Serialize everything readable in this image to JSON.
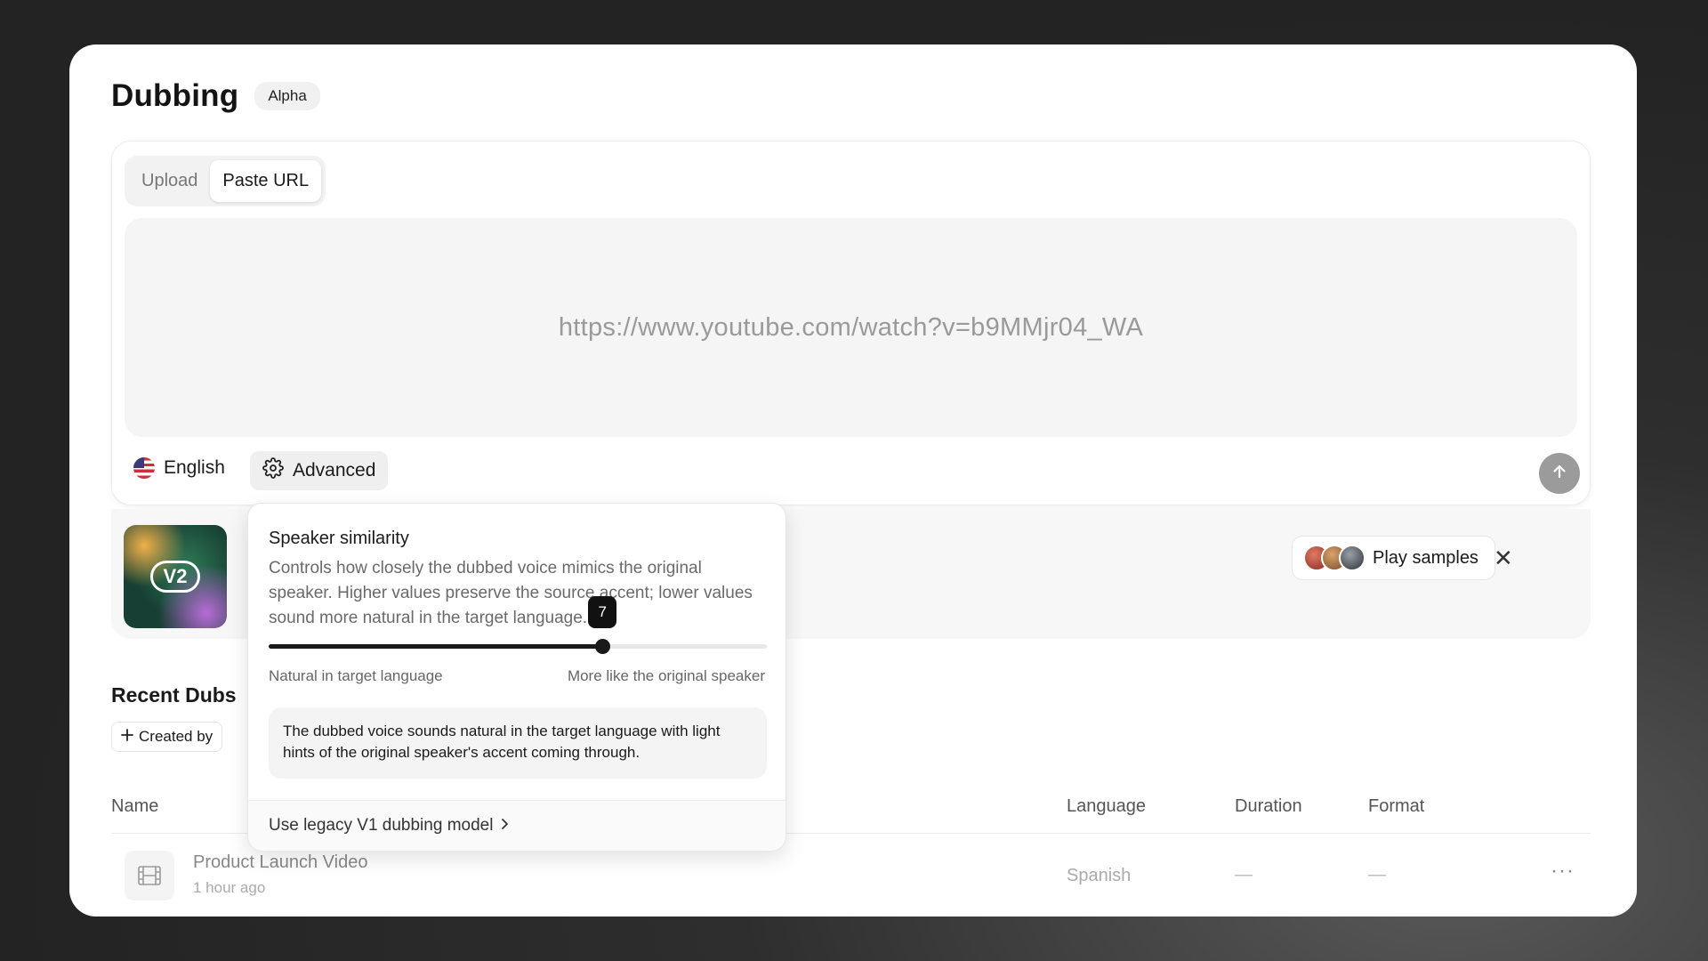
{
  "page": {
    "title": "Dubbing",
    "badge": "Alpha"
  },
  "input": {
    "tabs": [
      {
        "label": "Upload",
        "active": false
      },
      {
        "label": "Paste URL",
        "active": true
      }
    ],
    "url_value": "https://www.youtube.com/watch?v=b9MMjr04_WA",
    "language": {
      "label": "English",
      "flag_icon": "us-flag-icon"
    },
    "advanced_label": "Advanced",
    "submit_icon": "arrow-up-icon"
  },
  "model_card": {
    "badge": "V2",
    "play_samples_label": "Play samples",
    "close_symbol": "✕"
  },
  "recent": {
    "title": "Recent Dubs",
    "filter_label": "Created by",
    "columns": {
      "name": "Name",
      "language": "Language",
      "duration": "Duration",
      "format": "Format"
    },
    "rows": [
      {
        "name": "Product Launch Video",
        "time": "1 hour ago",
        "language": "Spanish",
        "duration": "—",
        "format": "—",
        "more": "···"
      }
    ]
  },
  "advanced_popover": {
    "title": "Speaker similarity",
    "description": "Controls how closely the dubbed voice mimics the original speaker. Higher values preserve the source accent; lower values sound more natural in the target language.",
    "slider": {
      "value": "7",
      "fraction": 0.67
    },
    "label_left": "Natural in target language",
    "label_right": "More like the original speaker",
    "note": "The dubbed voice sounds natural in the target language with light hints of the original speaker's accent coming through.",
    "legacy_link": "Use legacy V1 dubbing model"
  },
  "colors": {
    "accent": "#1a1a1a",
    "submit_disabled": "#9b9b9b",
    "flag_red": "#c8313a",
    "flag_blue": "#3c3b7a"
  }
}
